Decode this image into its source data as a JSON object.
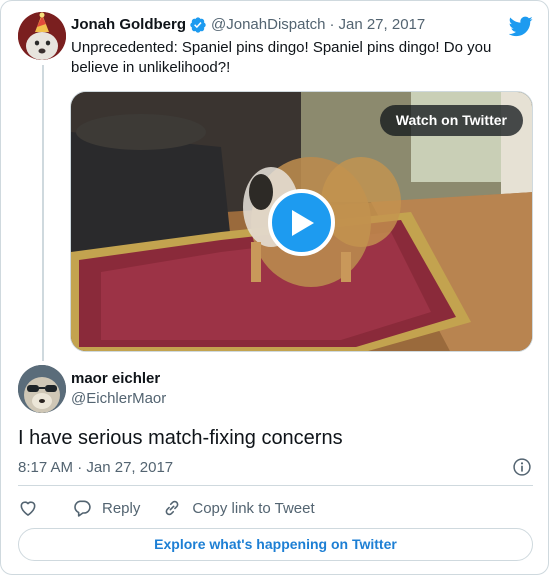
{
  "parent_tweet": {
    "name": "Jonah Goldberg",
    "handle": "@JonahDispatch",
    "separator": "·",
    "date": "Jan 27, 2017",
    "text": "Unprecedented: Spaniel pins dingo! Spaniel pins dingo! Do you believe in unlikelihood?!",
    "avatar_icon": "dog-with-party-hat-avatar",
    "verified_icon": "verified-badge-icon"
  },
  "media": {
    "watch_label": "Watch on Twitter",
    "play_icon": "play-icon",
    "thumbnail": "dogs-playing-on-red-rug"
  },
  "reply_tweet": {
    "name": "maor eichler",
    "handle": "@EichlerMaor",
    "text": "I have serious match-fixing concerns",
    "time": "8:17 AM",
    "separator": "·",
    "date": "Jan 27, 2017",
    "avatar_icon": "dog-with-sunglasses-avatar"
  },
  "actions": {
    "like_icon": "heart-icon",
    "reply_label": "Reply",
    "reply_icon": "reply-bubble-icon",
    "copy_label": "Copy link to Tweet",
    "copy_icon": "link-icon"
  },
  "explore_label": "Explore what's happening on Twitter",
  "brand_icon": "twitter-bird-icon",
  "colors": {
    "brand_blue": "#1d9bf0",
    "link_blue": "#1d7fd4",
    "text_primary": "#0f1419",
    "text_secondary": "#536471",
    "border": "#cfd9de"
  }
}
